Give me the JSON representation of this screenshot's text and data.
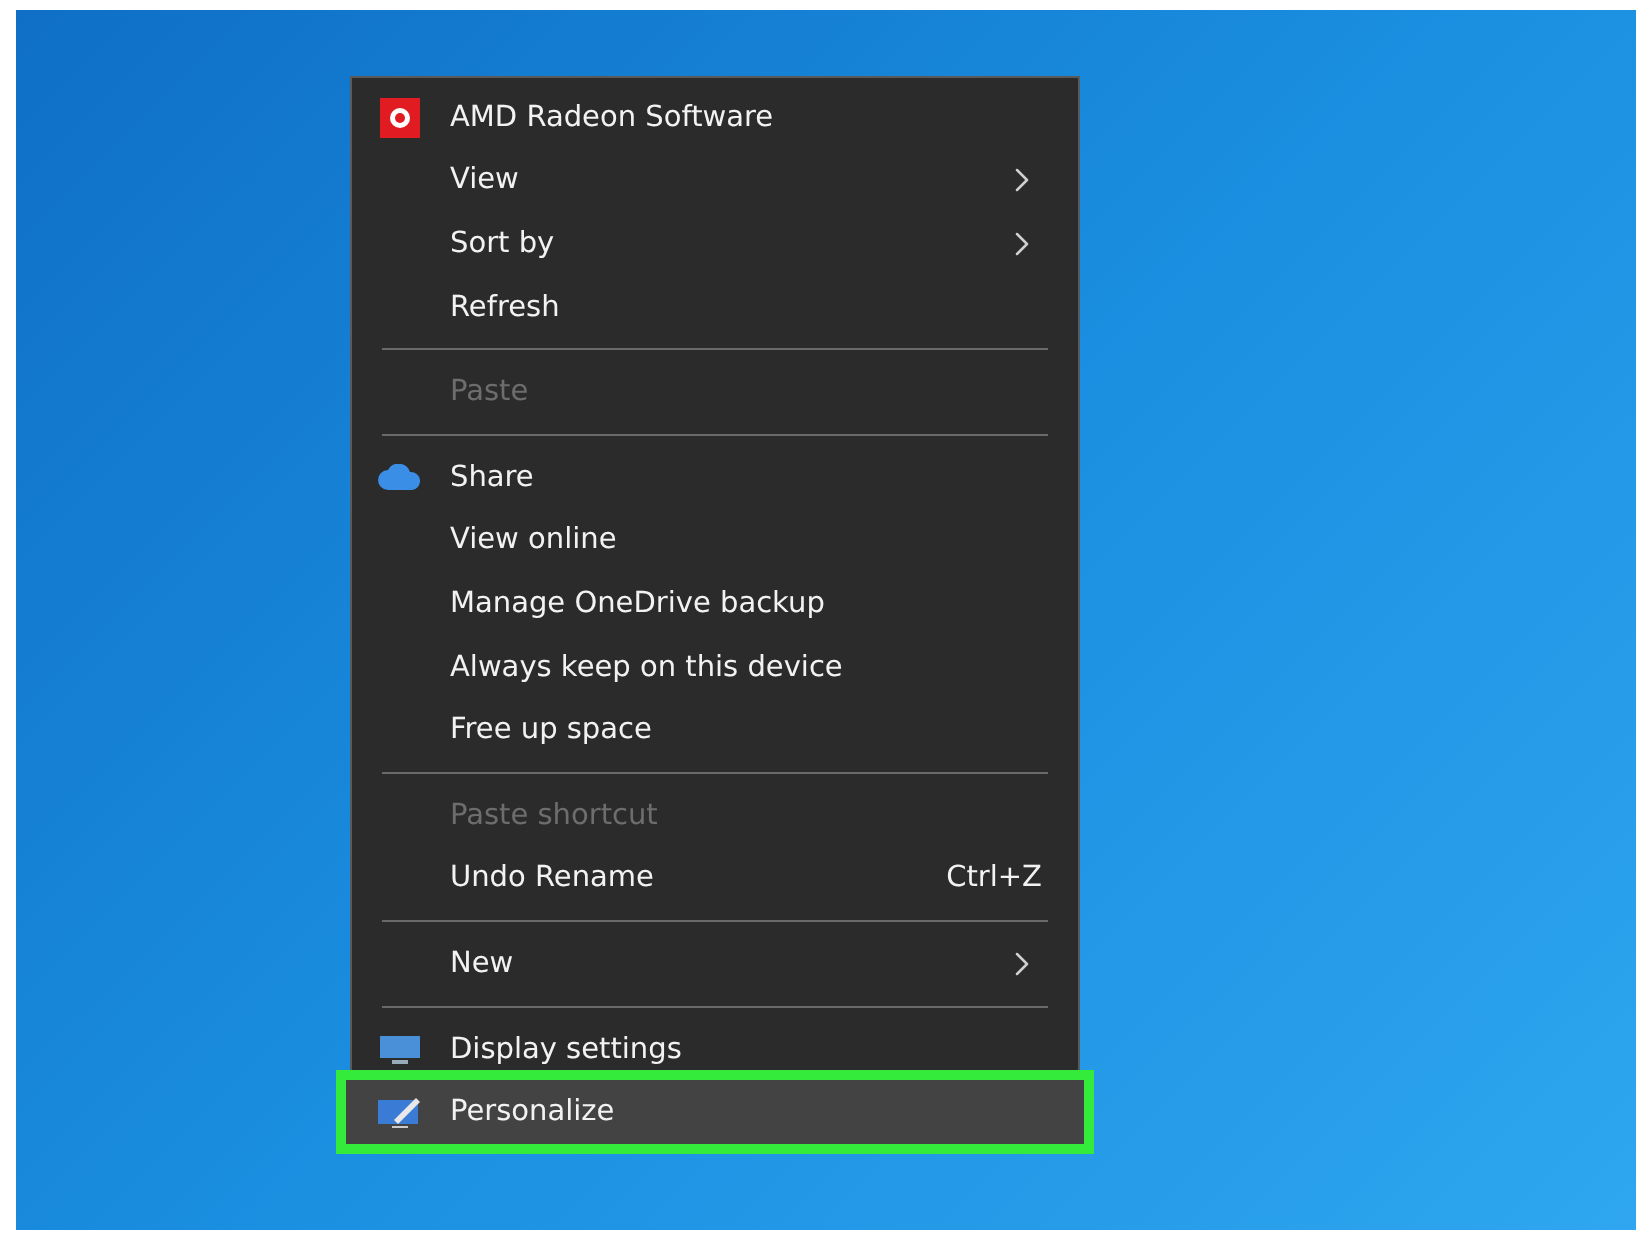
{
  "context_menu": {
    "items": [
      {
        "kind": "logo",
        "label": "AMD Radeon Software",
        "disabled": false,
        "submenu": false,
        "selected": false
      },
      {
        "kind": "item",
        "label": "View",
        "disabled": false,
        "submenu": true,
        "selected": false
      },
      {
        "kind": "item",
        "label": "Sort by",
        "disabled": false,
        "submenu": true,
        "selected": false
      },
      {
        "kind": "item",
        "label": "Refresh",
        "disabled": false,
        "submenu": false,
        "selected": false
      },
      {
        "kind": "separator"
      },
      {
        "kind": "item",
        "label": "Paste",
        "disabled": true,
        "submenu": false,
        "selected": false
      },
      {
        "kind": "separator"
      },
      {
        "kind": "cloud",
        "label": "Share",
        "disabled": false,
        "submenu": false,
        "selected": false
      },
      {
        "kind": "item",
        "label": "View online",
        "disabled": false,
        "submenu": false,
        "selected": false
      },
      {
        "kind": "item",
        "label": "Manage OneDrive backup",
        "disabled": false,
        "submenu": false,
        "selected": false
      },
      {
        "kind": "item",
        "label": "Always keep on this device",
        "disabled": false,
        "submenu": false,
        "selected": false
      },
      {
        "kind": "item",
        "label": "Free up space",
        "disabled": false,
        "submenu": false,
        "selected": false
      },
      {
        "kind": "separator"
      },
      {
        "kind": "item",
        "label": "Paste shortcut",
        "disabled": true,
        "submenu": false,
        "selected": false
      },
      {
        "kind": "item",
        "label": "Undo Rename",
        "shortcut": "Ctrl+Z",
        "disabled": false,
        "submenu": false,
        "selected": false
      },
      {
        "kind": "separator"
      },
      {
        "kind": "item",
        "label": "New",
        "disabled": false,
        "submenu": true,
        "selected": false
      },
      {
        "kind": "separator"
      },
      {
        "kind": "display",
        "label": "Display settings",
        "disabled": false,
        "submenu": false,
        "selected": false
      },
      {
        "kind": "personalize",
        "label": "Personalize",
        "disabled": false,
        "submenu": false,
        "selected": true
      }
    ]
  }
}
